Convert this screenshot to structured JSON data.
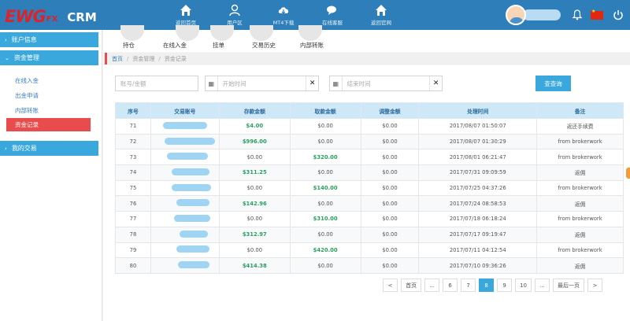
{
  "app": {
    "logo_main": "EWG",
    "logo_fx": "FX",
    "logo_crm": "CRM"
  },
  "topnav": [
    {
      "icon": "home-icon",
      "label": "返回首页"
    },
    {
      "icon": "user-icon",
      "label": "用户区"
    },
    {
      "icon": "cloud-download-icon",
      "label": "MT4下载"
    },
    {
      "icon": "chat-icon",
      "label": "在线客服"
    },
    {
      "icon": "home-icon",
      "label": "返回官网"
    }
  ],
  "tabs": [
    "持仓",
    "在线入金",
    "挂单",
    "交易历史",
    "内部转账"
  ],
  "sidebar": {
    "account_info": "账户信息",
    "funds_mgmt": "资金管理",
    "sub_items": [
      "在线入金",
      "出金申请",
      "内部转账",
      "资金记录"
    ],
    "active_index": 3,
    "my_trades": "我的交易"
  },
  "breadcrumb": [
    "首页",
    "资金管理",
    "资金记录"
  ],
  "filters": {
    "account_placeholder": "账号/金额",
    "start_placeholder": "开始时间",
    "end_placeholder": "结束时间",
    "search_label": "查查询"
  },
  "table": {
    "headers": [
      "序号",
      "交易账号",
      "存款金额",
      "取款金额",
      "调整金额",
      "处理时间",
      "备注"
    ],
    "rows": [
      {
        "no": "71",
        "deposit": "$4.00",
        "withdraw": "$0.00",
        "adjust": "$0.00",
        "time": "2017/08/07 01:50:07",
        "note": "返还手续费",
        "dep_pos": true,
        "wd_pos": false
      },
      {
        "no": "72",
        "deposit": "$996.00",
        "withdraw": "$0.00",
        "adjust": "$0.00",
        "time": "2017/08/07 01:30:29",
        "note": "from brokerwork",
        "dep_pos": true,
        "wd_pos": false
      },
      {
        "no": "73",
        "deposit": "$0.00",
        "withdraw": "$320.00",
        "adjust": "$0.00",
        "time": "2017/08/01 06:21:47",
        "note": "from brokerwork",
        "dep_pos": false,
        "wd_pos": true
      },
      {
        "no": "74",
        "deposit": "$311.25",
        "withdraw": "$0.00",
        "adjust": "$0.00",
        "time": "2017/07/31 09:09:59",
        "note": "返佣",
        "dep_pos": true,
        "wd_pos": false
      },
      {
        "no": "75",
        "deposit": "$0.00",
        "withdraw": "$140.00",
        "adjust": "$0.00",
        "time": "2017/07/25 04:37:26",
        "note": "from brokerwork",
        "dep_pos": false,
        "wd_pos": true
      },
      {
        "no": "76",
        "deposit": "$142.96",
        "withdraw": "$0.00",
        "adjust": "$0.00",
        "time": "2017/07/24 08:58:53",
        "note": "返佣",
        "dep_pos": true,
        "wd_pos": false
      },
      {
        "no": "77",
        "deposit": "$0.00",
        "withdraw": "$310.00",
        "adjust": "$0.00",
        "time": "2017/07/18 06:18:24",
        "note": "from brokerwork",
        "dep_pos": false,
        "wd_pos": true
      },
      {
        "no": "78",
        "deposit": "$312.97",
        "withdraw": "$0.00",
        "adjust": "$0.00",
        "time": "2017/07/17 09:19:47",
        "note": "返佣",
        "dep_pos": true,
        "wd_pos": false
      },
      {
        "no": "79",
        "deposit": "$0.00",
        "withdraw": "$420.00",
        "adjust": "$0.00",
        "time": "2017/07/11 04:12:54",
        "note": "from brokerwork",
        "dep_pos": false,
        "wd_pos": true
      },
      {
        "no": "80",
        "deposit": "$414.38",
        "withdraw": "$0.00",
        "adjust": "$0.00",
        "time": "2017/07/10 09:36:26",
        "note": "返佣",
        "dep_pos": true,
        "wd_pos": false
      }
    ]
  },
  "pagination": {
    "items": [
      "<",
      "首页",
      "...",
      "6",
      "7",
      "8",
      "9",
      "10",
      "...",
      "最后一页",
      ">"
    ],
    "current": "8"
  },
  "colors": {
    "topbar": "#2e7fb9",
    "accent": "#3aa7dd",
    "active_red": "#e84c4c",
    "positive": "#2aa15f"
  }
}
